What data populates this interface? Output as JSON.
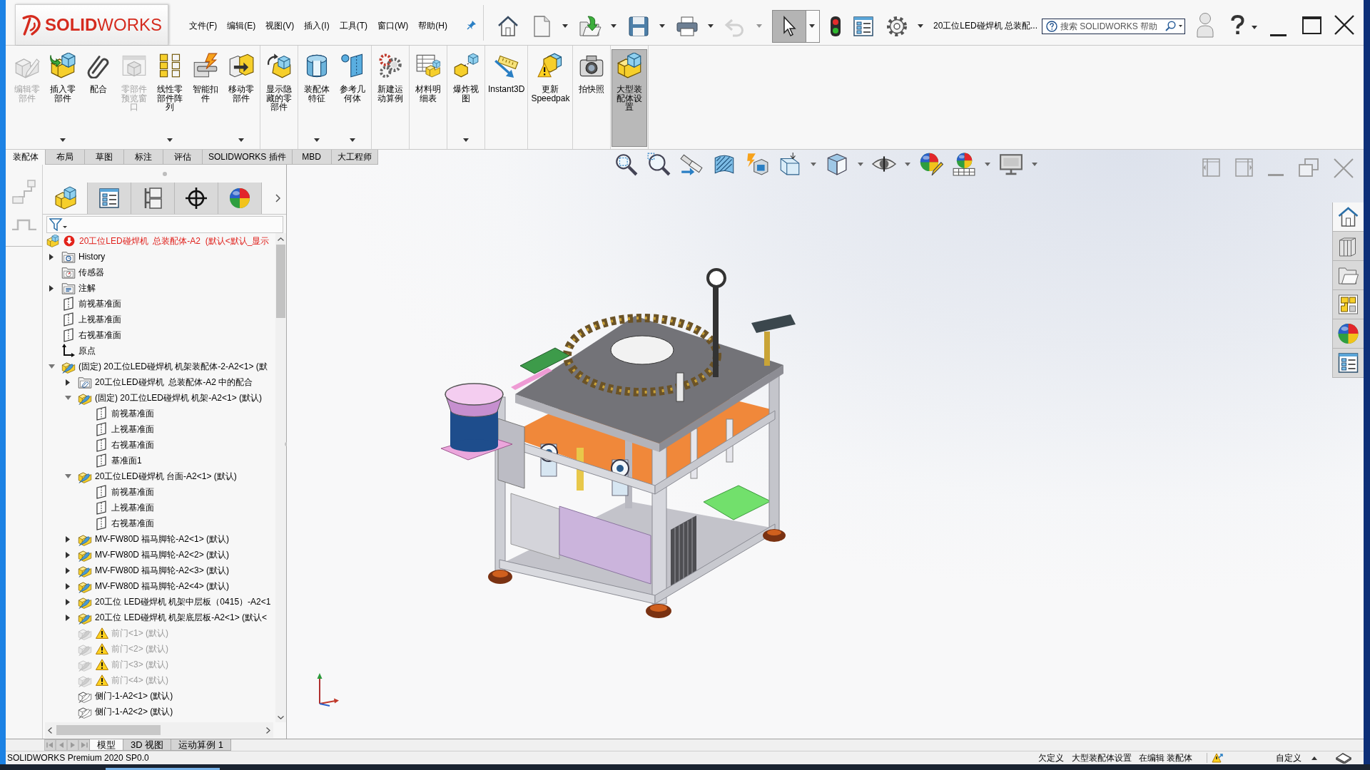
{
  "title_bar": {
    "logo": "**SOLID**WORKS",
    "menu": [
      "文件(F)",
      "编辑(E)",
      "视图(V)",
      "插入(I)",
      "工具(T)",
      "窗口(W)",
      "帮助(H)"
    ],
    "quick_access": [
      {
        "dropdown": false,
        "disabled": false,
        "selected": false
      },
      {
        "dropdown": true,
        "disabled": false,
        "selected": false
      },
      {
        "dropdown": true,
        "disabled": false,
        "selected": false
      },
      {
        "dropdown": true,
        "disabled": false,
        "selected": false
      },
      {
        "dropdown": true,
        "disabled": false,
        "selected": false
      },
      {
        "dropdown": true,
        "disabled": true,
        "selected": false
      },
      {
        "dropdown": true,
        "disabled": false,
        "selected": true
      },
      {
        "dropdown": false,
        "disabled": false,
        "selected": false
      },
      {
        "dropdown": false,
        "disabled": false,
        "selected": false
      },
      {
        "dropdown": true,
        "disabled": false,
        "selected": false
      }
    ],
    "document_title": "20工位LED碰焊机 总装配...",
    "search": {
      "placeholder": "搜索 SOLIDWORKS 帮助"
    }
  },
  "ribbon": {
    "groups": [
      {
        "commands": [
          {
            "label": "编辑零部件",
            "disabled": true,
            "dropdown": false,
            "selected": false
          },
          {
            "label": "插入零部件",
            "disabled": false,
            "dropdown": true,
            "selected": false
          },
          {
            "label": "配合",
            "disabled": false,
            "dropdown": false,
            "selected": false
          },
          {
            "label": "零部件预览窗口",
            "disabled": true,
            "dropdown": false,
            "selected": false
          },
          {
            "label": "线性零部件阵列",
            "disabled": false,
            "dropdown": true,
            "selected": false
          },
          {
            "label": "智能扣件",
            "disabled": false,
            "dropdown": false,
            "selected": false
          },
          {
            "label": "移动零部件",
            "disabled": false,
            "dropdown": true,
            "selected": false
          }
        ]
      },
      {
        "commands": [
          {
            "label": "显示隐藏的零部件",
            "disabled": false,
            "dropdown": false,
            "selected": false
          }
        ]
      },
      {
        "commands": [
          {
            "label": "装配体特征",
            "disabled": false,
            "dropdown": true,
            "selected": false
          },
          {
            "label": "参考几何体",
            "disabled": false,
            "dropdown": true,
            "selected": false
          }
        ]
      },
      {
        "commands": [
          {
            "label": "新建运动算例",
            "disabled": false,
            "dropdown": false,
            "selected": false
          }
        ]
      },
      {
        "commands": [
          {
            "label": "材料明细表",
            "disabled": false,
            "dropdown": false,
            "selected": false
          }
        ]
      },
      {
        "commands": [
          {
            "label": "爆炸视图",
            "disabled": false,
            "dropdown": true,
            "selected": false
          }
        ]
      },
      {
        "commands": [
          {
            "label": "Instant3D",
            "disabled": false,
            "dropdown": false,
            "selected": false
          }
        ]
      },
      {
        "commands": [
          {
            "label": "更新Speedpak",
            "disabled": false,
            "dropdown": false,
            "selected": false
          }
        ]
      },
      {
        "commands": [
          {
            "label": "拍快照",
            "disabled": false,
            "dropdown": false,
            "selected": false
          }
        ]
      },
      {
        "commands": [
          {
            "label": "大型装配体设置",
            "disabled": false,
            "dropdown": false,
            "selected": true
          }
        ]
      }
    ]
  },
  "command_tabs": [
    {
      "label": "装配体",
      "selected": true
    },
    {
      "label": "布局",
      "selected": false
    },
    {
      "label": "草图",
      "selected": false
    },
    {
      "label": "标注",
      "selected": false
    },
    {
      "label": "评估",
      "selected": false
    },
    {
      "label": "SOLIDWORKS 插件",
      "selected": false
    },
    {
      "label": "MBD",
      "selected": false
    },
    {
      "label": "大工程师",
      "selected": false
    }
  ],
  "feature_manager": {
    "tabs": [
      {
        "selected": true
      },
      {
        "selected": false
      },
      {
        "selected": false
      },
      {
        "selected": false
      },
      {
        "selected": false
      }
    ],
    "tree": [
      {
        "label": "20工位LED碰焊机  总装配体-A2  (默认<默认_显示",
        "kind": "assembly",
        "error": true,
        "children": [
          {
            "label": "History",
            "kind": "history",
            "expanded": false
          },
          {
            "label": "传感器",
            "kind": "sensors"
          },
          {
            "label": "注解",
            "kind": "annotations",
            "expanded": false
          },
          {
            "label": "前视基准面",
            "kind": "plane"
          },
          {
            "label": "上视基准面",
            "kind": "plane"
          },
          {
            "label": "右视基准面",
            "kind": "plane"
          },
          {
            "label": "原点",
            "kind": "origin"
          },
          {
            "label": "(固定) 20工位LED碰焊机 机架装配体-2-A2<1> (默",
            "kind": "component",
            "expanded": true,
            "children": [
              {
                "label": "20工位LED碰焊机  总装配体-A2 中的配合",
                "kind": "mates",
                "expanded": false,
                "suppressed": false,
                "warning": false
              },
              {
                "label": "(固定) 20工位LED碰焊机 机架-A2<1> (默认)",
                "kind": "component",
                "expanded": true,
                "suppressed": false,
                "warning": false,
                "children": [
                  {
                    "label": "前视基准面",
                    "kind": "plane"
                  },
                  {
                    "label": "上视基准面",
                    "kind": "plane"
                  },
                  {
                    "label": "右视基准面",
                    "kind": "plane"
                  },
                  {
                    "label": "基准面1",
                    "kind": "plane"
                  }
                ]
              },
              {
                "label": "20工位LED碰焊机 台面-A2<1> (默认)",
                "kind": "component",
                "expanded": true,
                "suppressed": false,
                "warning": false,
                "children": [
                  {
                    "label": "前视基准面",
                    "kind": "plane"
                  },
                  {
                    "label": "上视基准面",
                    "kind": "plane"
                  },
                  {
                    "label": "右视基准面",
                    "kind": "plane"
                  }
                ]
              },
              {
                "label": "MV-FW80D 福马脚轮-A2<1> (默认)",
                "kind": "component",
                "expanded": false,
                "suppressed": false,
                "warning": false
              },
              {
                "label": "MV-FW80D 福马脚轮-A2<2> (默认)",
                "kind": "component",
                "expanded": false,
                "suppressed": false,
                "warning": false
              },
              {
                "label": "MV-FW80D 福马脚轮-A2<3> (默认)",
                "kind": "component",
                "expanded": false,
                "suppressed": false,
                "warning": false
              },
              {
                "label": "MV-FW80D 福马脚轮-A2<4> (默认)",
                "kind": "component",
                "expanded": false,
                "suppressed": false,
                "warning": false
              },
              {
                "label": "20工位 LED碰焊机 机架中层板（0415）-A2<1",
                "kind": "component",
                "expanded": false,
                "suppressed": false,
                "warning": false
              },
              {
                "label": "20工位 LED碰焊机 机架底层板-A2<1> (默认<",
                "kind": "component",
                "expanded": false,
                "suppressed": false,
                "warning": false
              },
              {
                "label": "前门<1> (默认)",
                "kind": "component",
                "suppressed": true,
                "warning": true
              },
              {
                "label": "前门<2> (默认)",
                "kind": "component",
                "suppressed": true,
                "warning": true
              },
              {
                "label": "前门<3> (默认)",
                "kind": "component",
                "suppressed": true,
                "warning": true
              },
              {
                "label": "前门<4> (默认)",
                "kind": "component",
                "suppressed": true,
                "warning": true
              },
              {
                "label": "侧门-1-A2<1> (默认)",
                "kind": "component-outline",
                "suppressed": false,
                "warning": false
              },
              {
                "label": "侧门-1-A2<2> (默认)",
                "kind": "component-outline",
                "suppressed": false,
                "warning": false
              }
            ]
          }
        ]
      }
    ]
  },
  "task_pane": {
    "tabs": [
      {
        "selected": true
      },
      {
        "selected": false
      },
      {
        "selected": false
      },
      {
        "selected": false
      },
      {
        "selected": false
      },
      {
        "selected": false
      }
    ]
  },
  "sheet_tabs": [
    {
      "label": "模型",
      "selected": true
    },
    {
      "label": "3D 视图",
      "selected": false
    },
    {
      "label": "运动算例 1",
      "selected": false
    }
  ],
  "status_bar": {
    "product": "SOLIDWORKS Premium 2020 SP0.0",
    "messages": [
      "欠定义",
      "大型装配体设置",
      "在编辑 装配体"
    ],
    "unit_system": "自定义"
  }
}
